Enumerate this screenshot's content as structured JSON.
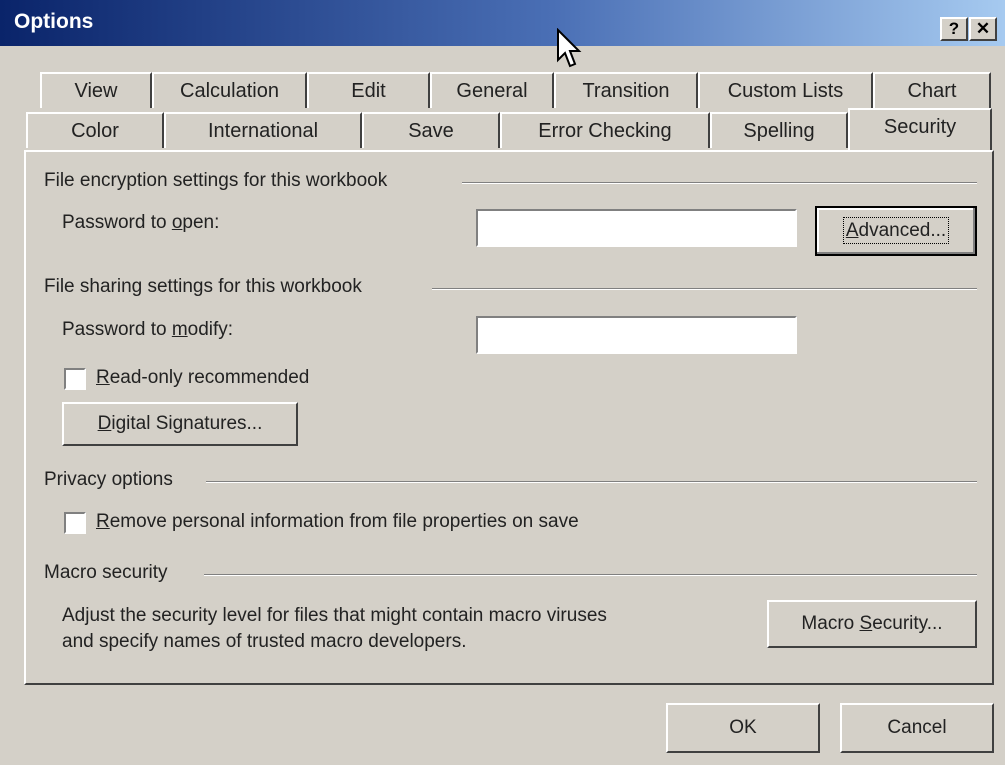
{
  "window": {
    "title": "Options",
    "help_label": "?",
    "close_label": "✕"
  },
  "tabs": {
    "row_back": [
      "View",
      "Calculation",
      "Edit",
      "General",
      "Transition",
      "Custom Lists",
      "Chart"
    ],
    "row_front": [
      "Color",
      "International",
      "Save",
      "Error Checking",
      "Spelling",
      "Security"
    ],
    "active": "Security"
  },
  "encryption": {
    "group_label": "File encryption settings for this workbook",
    "password_open_pre": "Password to ",
    "password_open_key": "o",
    "password_open_post": "pen:",
    "password_open_value": "",
    "advanced_key": "A",
    "advanced_rest": "dvanced..."
  },
  "sharing": {
    "group_label": "File sharing settings for this workbook",
    "password_modify_pre": "Password to ",
    "password_modify_key": "m",
    "password_modify_post": "odify:",
    "password_modify_value": "",
    "readonly_key": "R",
    "readonly_rest": "ead-only recommended",
    "readonly_checked": false,
    "digsig_key": "D",
    "digsig_rest": "igital Signatures..."
  },
  "privacy": {
    "group_label": "Privacy options",
    "remove_key": "R",
    "remove_rest": "emove personal information from file properties on save",
    "remove_checked": false
  },
  "macro": {
    "group_label": "Macro security",
    "desc_line1": "Adjust the security level for files that might contain macro viruses",
    "desc_line2": "and specify names of trusted macro developers.",
    "btn_pre": "Macro ",
    "btn_key": "S",
    "btn_post": "ecurity..."
  },
  "footer": {
    "ok_label": "OK",
    "cancel_label": "Cancel"
  }
}
